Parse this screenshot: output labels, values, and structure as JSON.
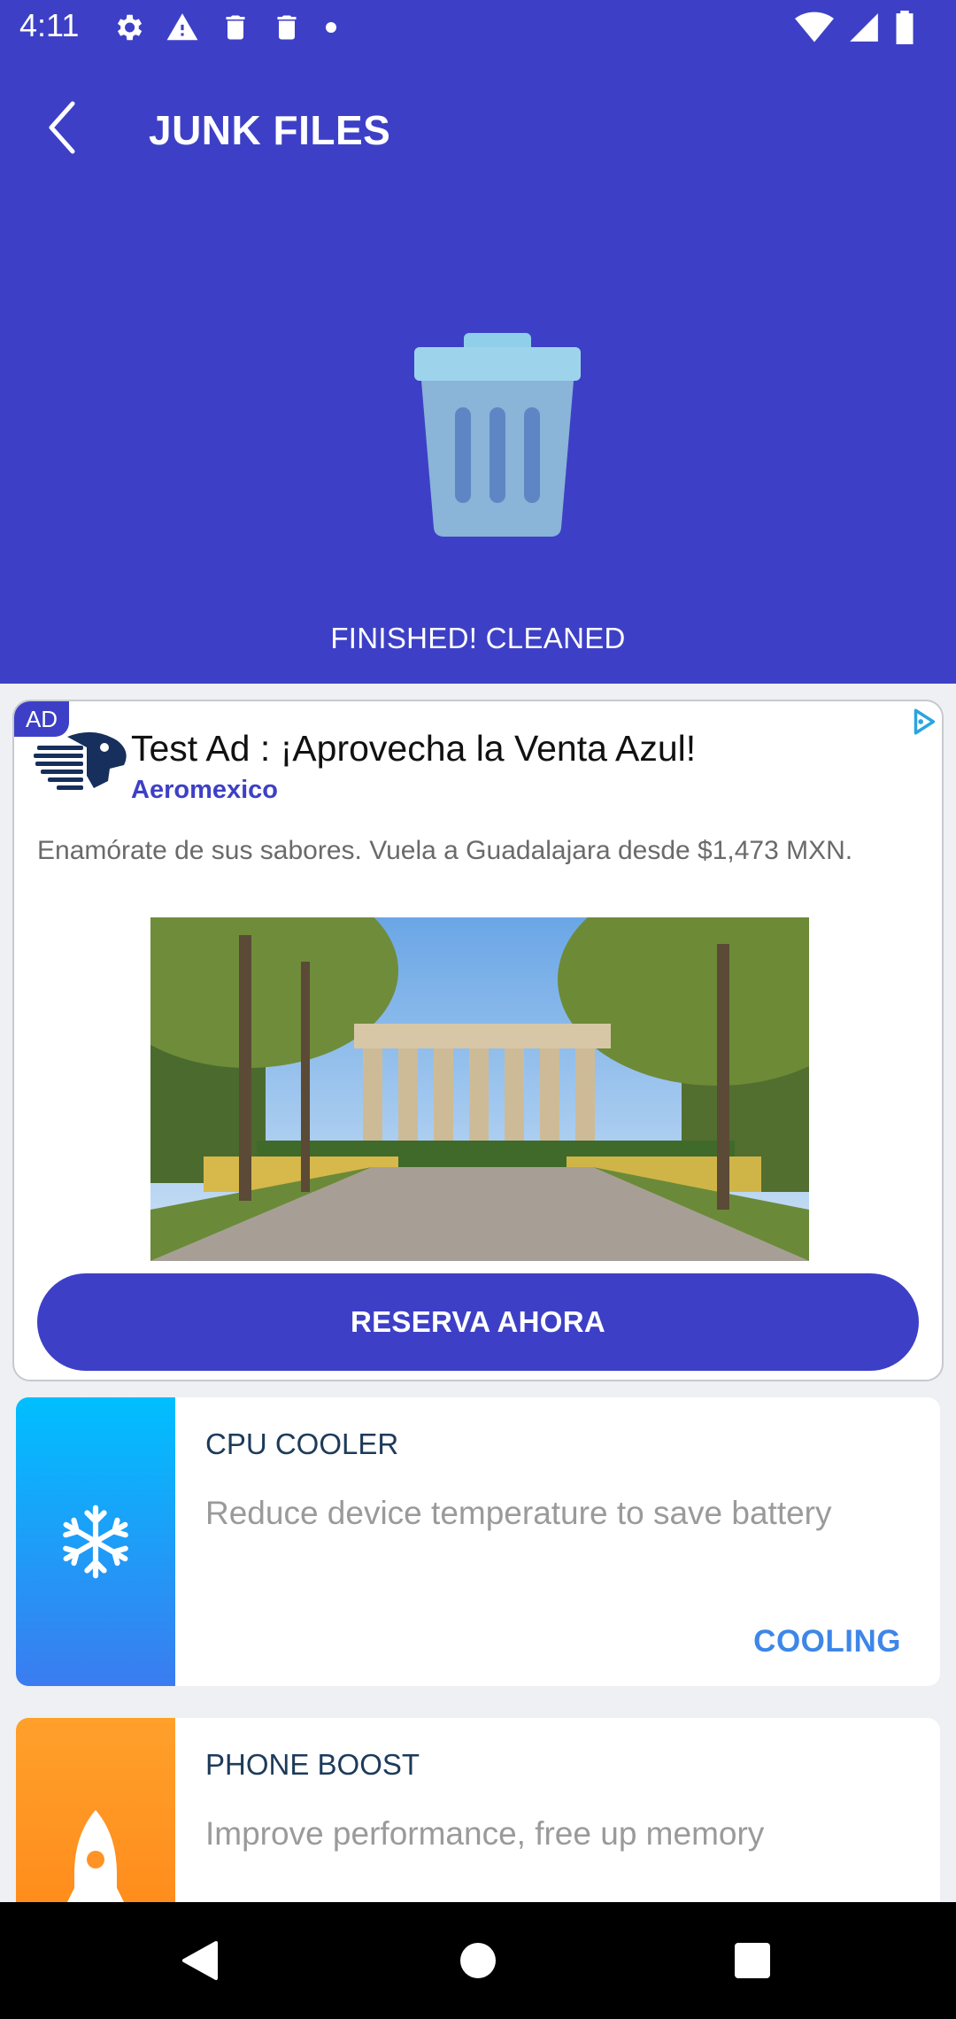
{
  "status_bar": {
    "time": "4:11",
    "left_icons": [
      "gear-icon",
      "warning-icon",
      "trash-icon",
      "trash-icon",
      "dot-icon"
    ],
    "right_icons": [
      "wifi-icon",
      "signal-icon",
      "battery-icon"
    ]
  },
  "app_bar": {
    "title": "JUNK FILES",
    "back_icon": "back-arrow-icon"
  },
  "hero": {
    "icon": "trash-can-icon",
    "status_text": "FINISHED! CLEANED"
  },
  "ad": {
    "badge": "AD",
    "headline": "Test Ad : ¡Aprovecha la Venta Azul!",
    "advertiser": "Aeromexico",
    "body": "Enamórate de sus sabores. Vuela a Guadalajara desde $1,473 MXN.",
    "image_alt": "Rotonda de los Jaliscienses Ilustres",
    "cta": "RESERVA AHORA",
    "colors": {
      "accent": "#3d40c6"
    }
  },
  "features": [
    {
      "title": "CPU COOLER",
      "description": "Reduce device temperature to save battery",
      "action": "COOLING",
      "icon": "snowflake-icon",
      "gradient": [
        "#00bfff",
        "#3b7cf0"
      ]
    },
    {
      "title": "PHONE BOOST",
      "description": "Improve performance, free up memory",
      "action": "",
      "icon": "rocket-icon",
      "gradient": [
        "#ffa02b",
        "#ff8a1a"
      ]
    }
  ],
  "nav": {
    "back": "nav-back-icon",
    "home": "nav-home-icon",
    "recents": "nav-recents-icon"
  },
  "colors": {
    "primary": "#3d40c6",
    "action_text": "#3e86e8",
    "background": "#eef0f3"
  }
}
